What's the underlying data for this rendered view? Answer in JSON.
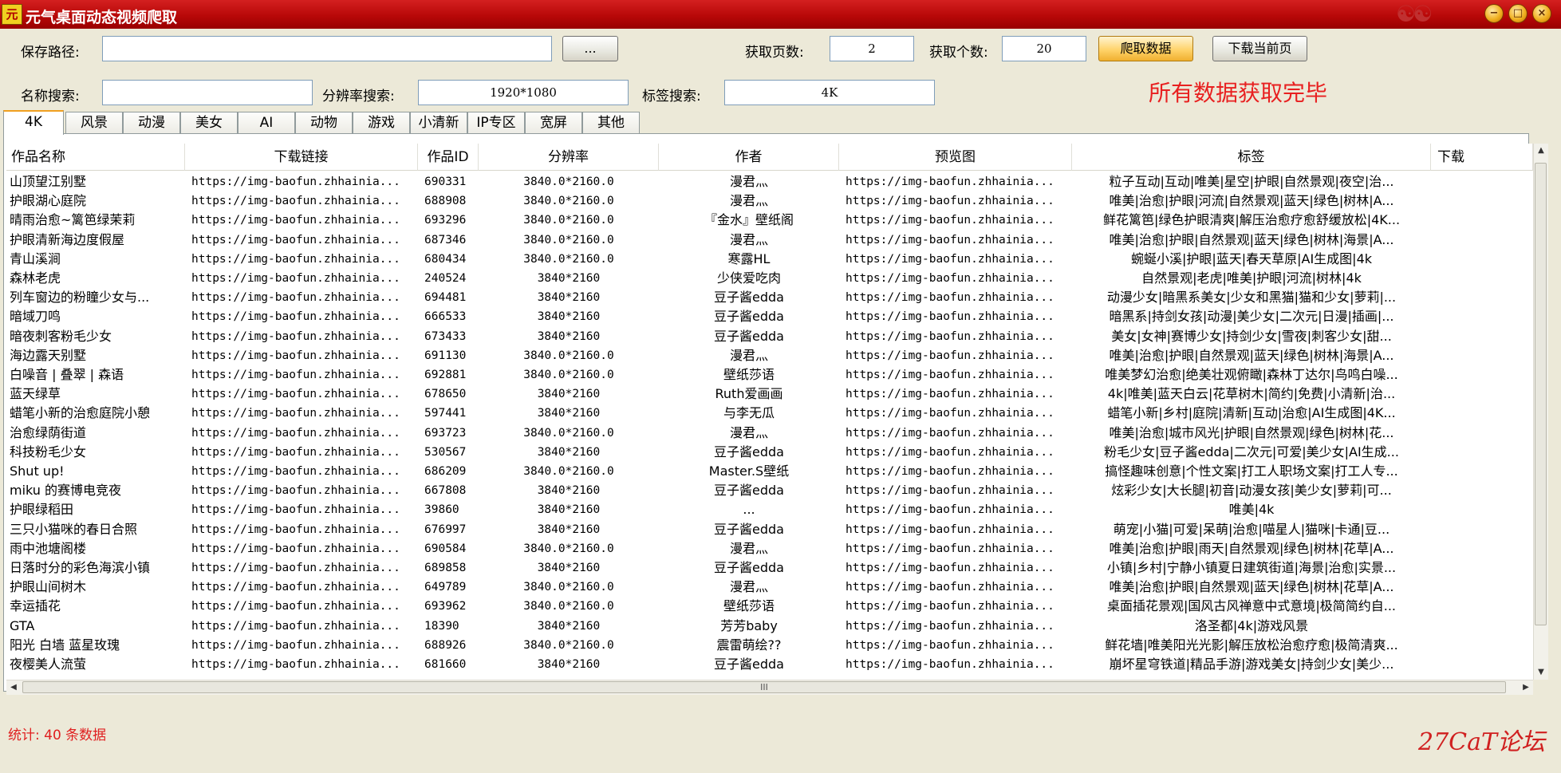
{
  "window": {
    "title": "元气桌面动态视频爬取",
    "app_icon_text": "元"
  },
  "form": {
    "save_path_label": "保存路径:",
    "save_path_value": "",
    "browse_label": "...",
    "pages_label": "获取页数:",
    "pages_value": "2",
    "count_label": "获取个数:",
    "count_value": "20",
    "crawl_label": "爬取数据",
    "download_page_label": "下载当前页",
    "name_search_label": "名称搜索:",
    "name_search_value": "",
    "res_search_label": "分辨率搜索:",
    "res_search_value": "1920*1080",
    "tag_search_label": "标签搜索:",
    "tag_search_value": "4K",
    "status_message": "所有数据获取完毕"
  },
  "tabs": [
    "4K",
    "风景",
    "动漫",
    "美女",
    "AI",
    "动物",
    "游戏",
    "小清新",
    "IP专区",
    "宽屏",
    "其他"
  ],
  "active_tab": 0,
  "table": {
    "columns": [
      "作品名称",
      "下载链接",
      "作品ID",
      "分辨率",
      "作者",
      "预览图",
      "标签",
      "下载"
    ],
    "rows": [
      [
        "山顶望江别墅",
        "https://img-baofun.zhhainia...",
        "690331",
        "3840.0*2160.0",
        "漫君灬",
        "https://img-baofun.zhhainia...",
        "粒子互动|互动|唯美|星空|护眼|自然景观|夜空|治..."
      ],
      [
        "护眼湖心庭院",
        "https://img-baofun.zhhainia...",
        "688908",
        "3840.0*2160.0",
        "漫君灬",
        "https://img-baofun.zhhainia...",
        "唯美|治愈|护眼|河流|自然景观|蓝天|绿色|树林|A..."
      ],
      [
        "晴雨治愈~篱笆绿茉莉",
        "https://img-baofun.zhhainia...",
        "693296",
        "3840.0*2160.0",
        "『金水』壁纸阁",
        "https://img-baofun.zhhainia...",
        "鲜花篱笆|绿色护眼清爽|解压治愈疗愈舒缓放松|4K..."
      ],
      [
        "护眼清新海边度假屋",
        "https://img-baofun.zhhainia...",
        "687346",
        "3840.0*2160.0",
        "漫君灬",
        "https://img-baofun.zhhainia...",
        "唯美|治愈|护眼|自然景观|蓝天|绿色|树林|海景|A..."
      ],
      [
        "青山溪涧",
        "https://img-baofun.zhhainia...",
        "680434",
        "3840.0*2160.0",
        "寒露HL",
        "https://img-baofun.zhhainia...",
        "蜿蜒小溪|护眼|蓝天|春天草原|AI生成图|4k"
      ],
      [
        "森林老虎",
        "https://img-baofun.zhhainia...",
        "240524",
        "3840*2160",
        "少侠爱吃肉",
        "https://img-baofun.zhhainia...",
        "自然景观|老虎|唯美|护眼|河流|树林|4k"
      ],
      [
        "列车窗边的粉瞳少女与...",
        "https://img-baofun.zhhainia...",
        "694481",
        "3840*2160",
        "豆子酱edda",
        "https://img-baofun.zhhainia...",
        "动漫少女|暗黑系美女|少女和黑猫|猫和少女|萝莉|..."
      ],
      [
        "暗域刀鸣",
        "https://img-baofun.zhhainia...",
        "666533",
        "3840*2160",
        "豆子酱edda",
        "https://img-baofun.zhhainia...",
        "暗黑系|持剑女孩|动漫|美少女|二次元|日漫|插画|..."
      ],
      [
        "暗夜刺客粉毛少女",
        "https://img-baofun.zhhainia...",
        "673433",
        "3840*2160",
        "豆子酱edda",
        "https://img-baofun.zhhainia...",
        "美女|女神|赛博少女|持剑少女|雪夜|刺客少女|甜..."
      ],
      [
        "海边露天别墅",
        "https://img-baofun.zhhainia...",
        "691130",
        "3840.0*2160.0",
        "漫君灬",
        "https://img-baofun.zhhainia...",
        "唯美|治愈|护眼|自然景观|蓝天|绿色|树林|海景|A..."
      ],
      [
        "白噪音 | 叠翠 | 森语",
        "https://img-baofun.zhhainia...",
        "692881",
        "3840.0*2160.0",
        "壁纸莎语",
        "https://img-baofun.zhhainia...",
        "唯美梦幻治愈|绝美壮观俯瞰|森林丁达尔|鸟鸣白噪..."
      ],
      [
        "蓝天绿草",
        "https://img-baofun.zhhainia...",
        "678650",
        "3840*2160",
        "Ruth爱画画",
        "https://img-baofun.zhhainia...",
        "4k|唯美|蓝天白云|花草树木|简约|免费|小清新|治..."
      ],
      [
        "蜡笔小新的治愈庭院小憩",
        "https://img-baofun.zhhainia...",
        "597441",
        "3840*2160",
        "与李无瓜",
        "https://img-baofun.zhhainia...",
        "蜡笔小新|乡村|庭院|清新|互动|治愈|AI生成图|4K..."
      ],
      [
        "治愈绿荫街道",
        "https://img-baofun.zhhainia...",
        "693723",
        "3840.0*2160.0",
        "漫君灬",
        "https://img-baofun.zhhainia...",
        "唯美|治愈|城市风光|护眼|自然景观|绿色|树林|花..."
      ],
      [
        "科技粉毛少女",
        "https://img-baofun.zhhainia...",
        "530567",
        "3840*2160",
        "豆子酱edda",
        "https://img-baofun.zhhainia...",
        "粉毛少女|豆子酱edda|二次元|可爱|美少女|AI生成..."
      ],
      [
        "Shut  up!",
        "https://img-baofun.zhhainia...",
        "686209",
        "3840.0*2160.0",
        "Master.S壁纸",
        "https://img-baofun.zhhainia...",
        "搞怪趣味创意|个性文案|打工人职场文案|打工人专..."
      ],
      [
        "miku 的赛博电竞夜",
        "https://img-baofun.zhhainia...",
        "667808",
        "3840*2160",
        "豆子酱edda",
        "https://img-baofun.zhhainia...",
        "炫彩少女|大长腿|初音|动漫女孩|美少女|萝莉|可..."
      ],
      [
        "护眼绿稻田",
        "https://img-baofun.zhhainia...",
        "39860",
        "3840*2160",
        "...",
        "https://img-baofun.zhhainia...",
        "唯美|4k"
      ],
      [
        "三只小猫咪的春日合照",
        "https://img-baofun.zhhainia...",
        "676997",
        "3840*2160",
        "豆子酱edda",
        "https://img-baofun.zhhainia...",
        "萌宠|小猫|可爱|呆萌|治愈|喵星人|猫咪|卡通|豆..."
      ],
      [
        "雨中池塘阁楼",
        "https://img-baofun.zhhainia...",
        "690584",
        "3840.0*2160.0",
        "漫君灬",
        "https://img-baofun.zhhainia...",
        "唯美|治愈|护眼|雨天|自然景观|绿色|树林|花草|A..."
      ],
      [
        "日落时分的彩色海滨小镇",
        "https://img-baofun.zhhainia...",
        "689858",
        "3840*2160",
        "豆子酱edda",
        "https://img-baofun.zhhainia...",
        "小镇|乡村|宁静小镇夏日建筑街道|海景|治愈|实景..."
      ],
      [
        "护眼山间树木",
        "https://img-baofun.zhhainia...",
        "649789",
        "3840.0*2160.0",
        "漫君灬",
        "https://img-baofun.zhhainia...",
        "唯美|治愈|护眼|自然景观|蓝天|绿色|树林|花草|A..."
      ],
      [
        "幸运插花",
        "https://img-baofun.zhhainia...",
        "693962",
        "3840.0*2160.0",
        "壁纸莎语",
        "https://img-baofun.zhhainia...",
        "桌面插花景观|国风古风禅意中式意境|极简简约自..."
      ],
      [
        "GTA",
        "https://img-baofun.zhhainia...",
        "18390",
        "3840*2160",
        "芳芳baby",
        "https://img-baofun.zhhainia...",
        "洛圣都|4k|游戏风景"
      ],
      [
        "阳光 白墙 蓝星玫瑰",
        "https://img-baofun.zhhainia...",
        "688926",
        "3840.0*2160.0",
        "震雷萌绘??",
        "https://img-baofun.zhhainia...",
        "鲜花墙|唯美阳光光影|解压放松治愈疗愈|极简清爽..."
      ],
      [
        "夜樱美人流萤",
        "https://img-baofun.zhhainia...",
        "681660",
        "3840*2160",
        "豆子酱edda",
        "https://img-baofun.zhhainia...",
        "崩坏星穹铁道|精品手游|游戏美女|持剑少女|美少..."
      ]
    ]
  },
  "scrollbar": {
    "h_thumb_grip": "III"
  },
  "footer": {
    "stats": "统计: 40 条数据",
    "watermark": "27CaT论坛"
  },
  "colors": {
    "titlebar": "#b80808",
    "status_text": "#e82020",
    "stats_text": "#e02020",
    "window_bg": "#ece9d8"
  }
}
